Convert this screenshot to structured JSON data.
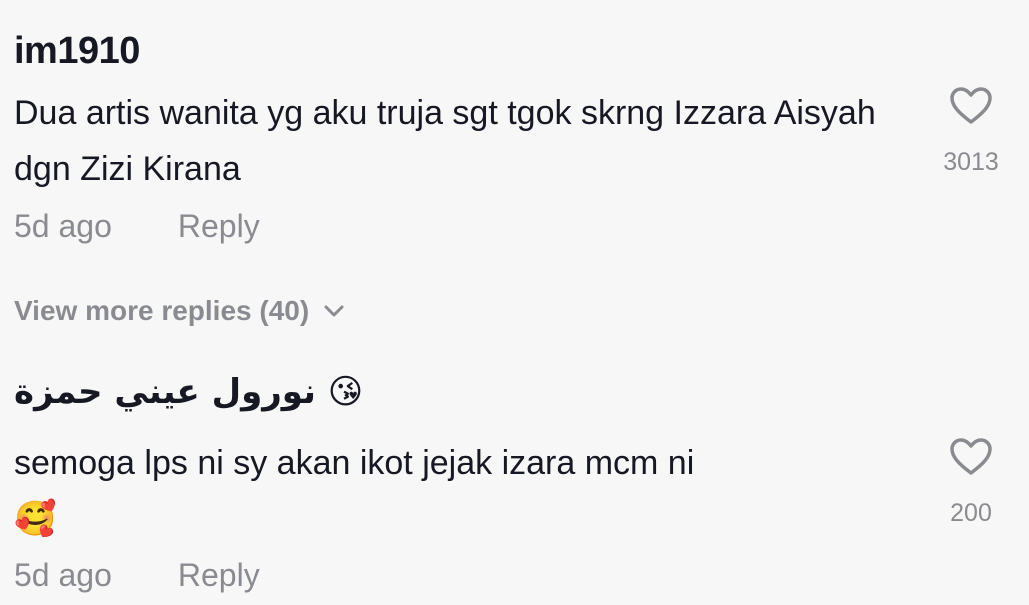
{
  "comments": [
    {
      "username": "im1910",
      "text": "Dua artis wanita yg aku truja sgt tgok skrng Izzara Aisyah dgn Zizi Kirana",
      "time": "5d ago",
      "reply_label": "Reply",
      "like_count": "3013",
      "view_more": "View more replies (40)"
    },
    {
      "username": "نورول عيني حمزة",
      "username_emoji": "😘",
      "text": "semoga lps ni sy akan ikot jejak izara mcm ni",
      "text_emoji": "🥰",
      "time": "5d ago",
      "reply_label": "Reply",
      "like_count": "200"
    }
  ],
  "icons": {
    "like": "heart-outline-icon",
    "expand": "chevron-down-icon"
  },
  "colors": {
    "background": "#f7f7f7",
    "text_primary": "#161823",
    "text_secondary": "#8a8b91"
  }
}
